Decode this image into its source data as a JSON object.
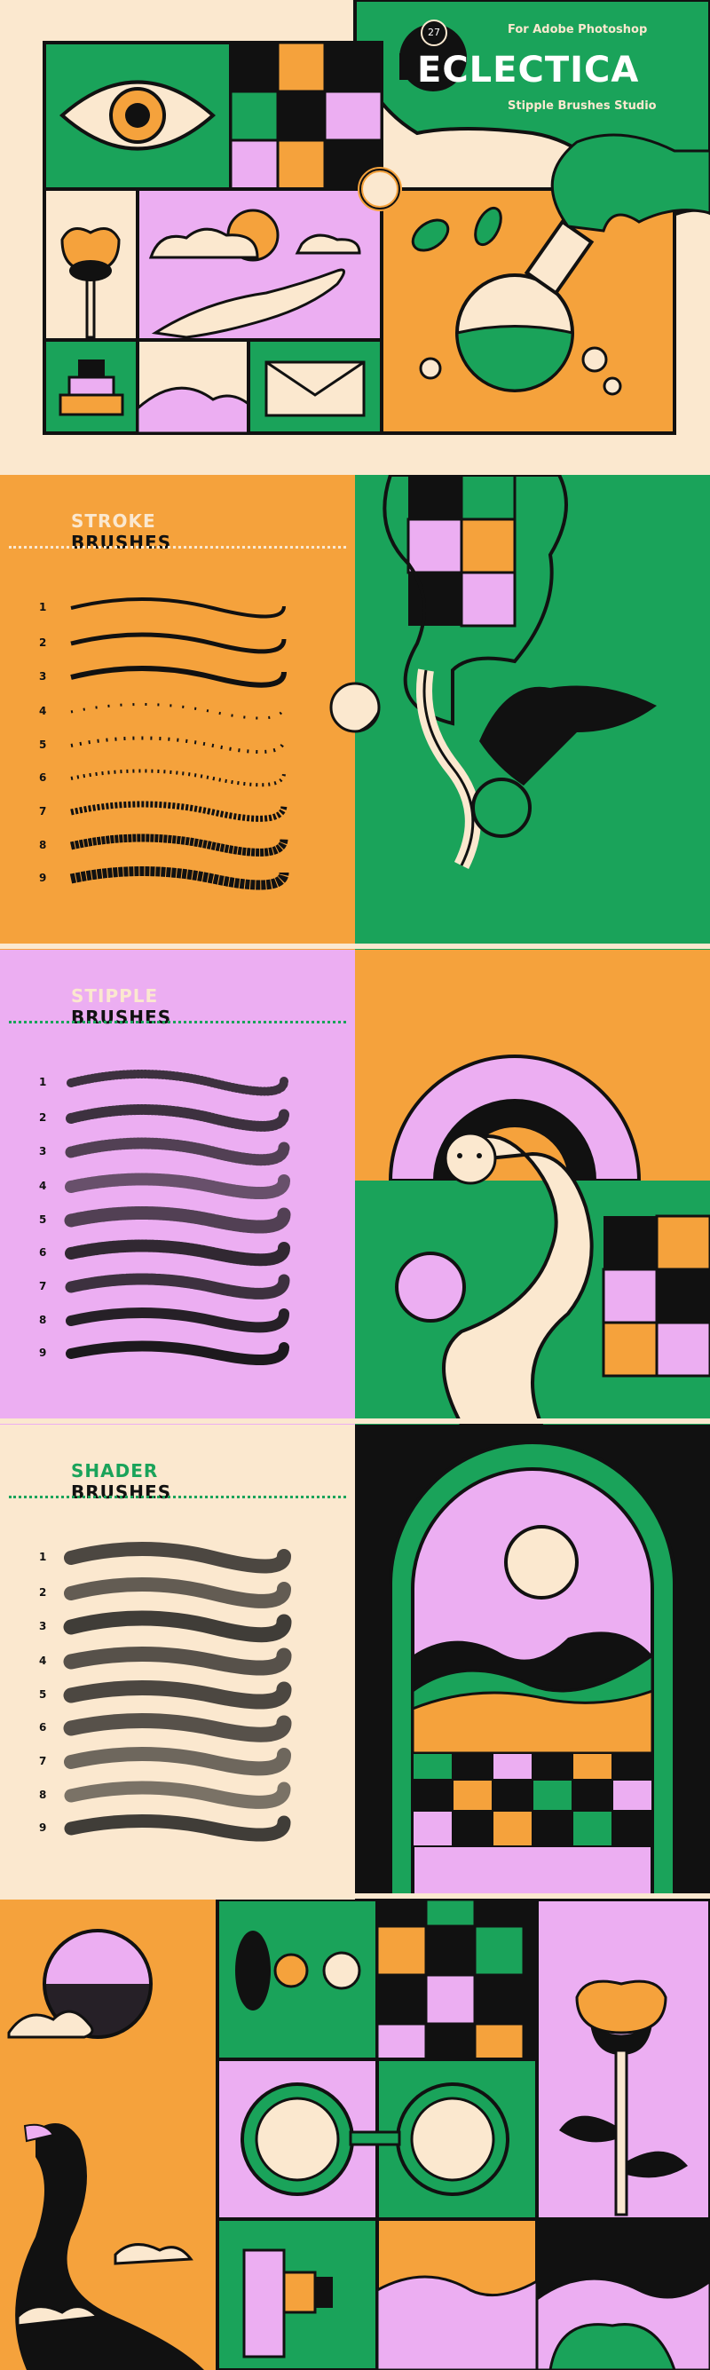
{
  "colors": {
    "cream": "#fbe8cf",
    "green": "#1aa35a",
    "orange": "#f5a23c",
    "pink": "#ecaef2",
    "black": "#111111"
  },
  "hero": {
    "badge": "27",
    "for_label": "For Adobe Photoshop",
    "product_name": "ECLECTICA",
    "subtitle": "Stipple Brushes Studio"
  },
  "sections": [
    {
      "heading_top": "STROKE",
      "heading_bottom": "BRUSHES",
      "numbers": [
        "1",
        "2",
        "3",
        "4",
        "5",
        "6",
        "7",
        "8",
        "9"
      ]
    },
    {
      "heading_top": "STIPPLE",
      "heading_bottom": "BRUSHES",
      "numbers": [
        "1",
        "2",
        "3",
        "4",
        "5",
        "6",
        "7",
        "8",
        "9"
      ]
    },
    {
      "heading_top": "SHADER",
      "heading_bottom": "BRUSHES",
      "numbers": [
        "1",
        "2",
        "3",
        "4",
        "5",
        "6",
        "7",
        "8",
        "9"
      ]
    }
  ]
}
